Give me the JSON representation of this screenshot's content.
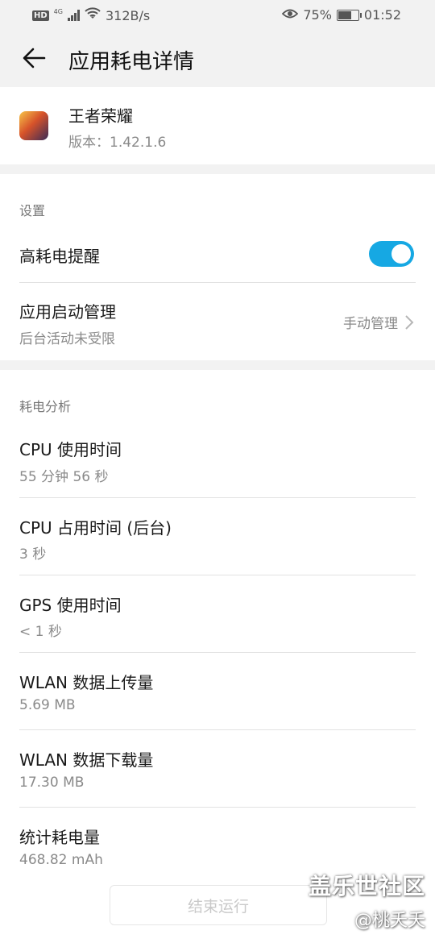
{
  "status": {
    "network_speed": "312B/s",
    "network_type": "4G",
    "hd_badge": "HD",
    "battery_percent": "75%",
    "battery_level": 0.75,
    "time": "01:52"
  },
  "header": {
    "title": "应用耗电详情"
  },
  "app": {
    "name": "王者荣耀",
    "version": "版本：1.42.1.6"
  },
  "settings": {
    "section_label": "设置",
    "high_power_alert": {
      "label": "高耗电提醒",
      "enabled": true
    },
    "startup": {
      "title": "应用启动管理",
      "subtitle": "后台活动未受限",
      "value": "手动管理"
    }
  },
  "analysis": {
    "section_label": "耗电分析",
    "items": [
      {
        "title": "CPU 使用时间",
        "value": "55 分钟 56 秒"
      },
      {
        "title": "CPU 占用时间 (后台)",
        "value": "3 秒"
      },
      {
        "title": "GPS 使用时间",
        "value": "< 1 秒"
      },
      {
        "title": "WLAN 数据上传量",
        "value": "5.69 MB"
      },
      {
        "title": "WLAN 数据下载量",
        "value": "17.30 MB"
      },
      {
        "title": "统计耗电量",
        "value": "468.82 mAh"
      }
    ]
  },
  "end_button": {
    "label": "结束运行"
  },
  "watermark": {
    "line1": "盖乐世社区",
    "line2": "@桃夭夭"
  },
  "colors": {
    "accent": "#16a8e3",
    "background_gray": "#f2f2f2"
  }
}
